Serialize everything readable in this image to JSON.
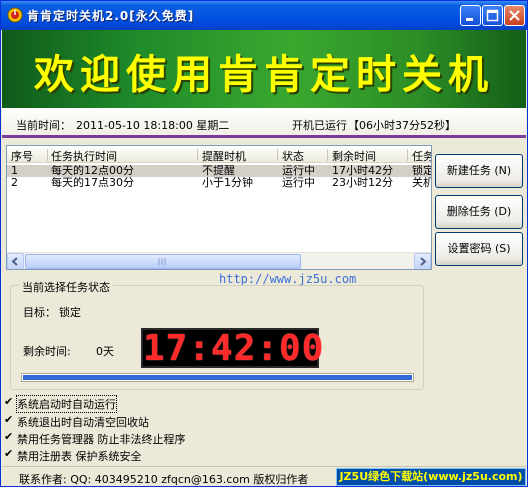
{
  "window": {
    "title": "肯肯定时关机2.0[永久免费]"
  },
  "banner": {
    "text": "欢迎使用肯肯定时关机"
  },
  "status": {
    "current_time_label": "当前时间：",
    "current_time": "2011-05-10  18:18:00  星期二",
    "uptime_label": "开机已运行",
    "uptime": "【06小时37分52秒】"
  },
  "task_list": {
    "columns": [
      "序号",
      "任务执行时间",
      "提醒时机",
      "状态",
      "剩余时间",
      "任务"
    ],
    "rows": [
      [
        "1",
        "每天的12点00分",
        "不提醒",
        "运行中",
        "17小时42分",
        "锁定"
      ],
      [
        "2",
        "每天的17点30分",
        "小于1分钟",
        "运行中",
        "23小时12分",
        "关机"
      ]
    ]
  },
  "buttons": {
    "new_task": "新建任务 (N)",
    "delete_task": "删除任务 (D)",
    "set_password": "设置密码 (S)"
  },
  "url": "http://www.jz5u.com",
  "current_task": {
    "group_title": "当前选择任务状态",
    "target_label": "目标：",
    "target_value": "锁定",
    "remain_label": "剩余时间:",
    "remain_days": "0天",
    "clock": "17:42:00",
    "progress": 1.0
  },
  "options": [
    {
      "label": "系统启动时自动运行",
      "checked": true
    },
    {
      "label": "系统退出时自动清空回收站",
      "checked": true
    },
    {
      "label": "禁用任务管理器 防止非法终止程序",
      "checked": true
    },
    {
      "label": "禁用注册表 保护系统安全",
      "checked": true
    }
  ],
  "footer": {
    "contact": "联系作者: QQ: 403495210 zfqcn@163.com 版权归作者",
    "site_badge": "JZ5U绿色下载站(www.jz5u.com)"
  },
  "colors": {
    "titlebar": "#0554e3",
    "banner_text": "#ffff00",
    "clock_digits": "#ff2a2a",
    "progress": "#3069d4"
  }
}
